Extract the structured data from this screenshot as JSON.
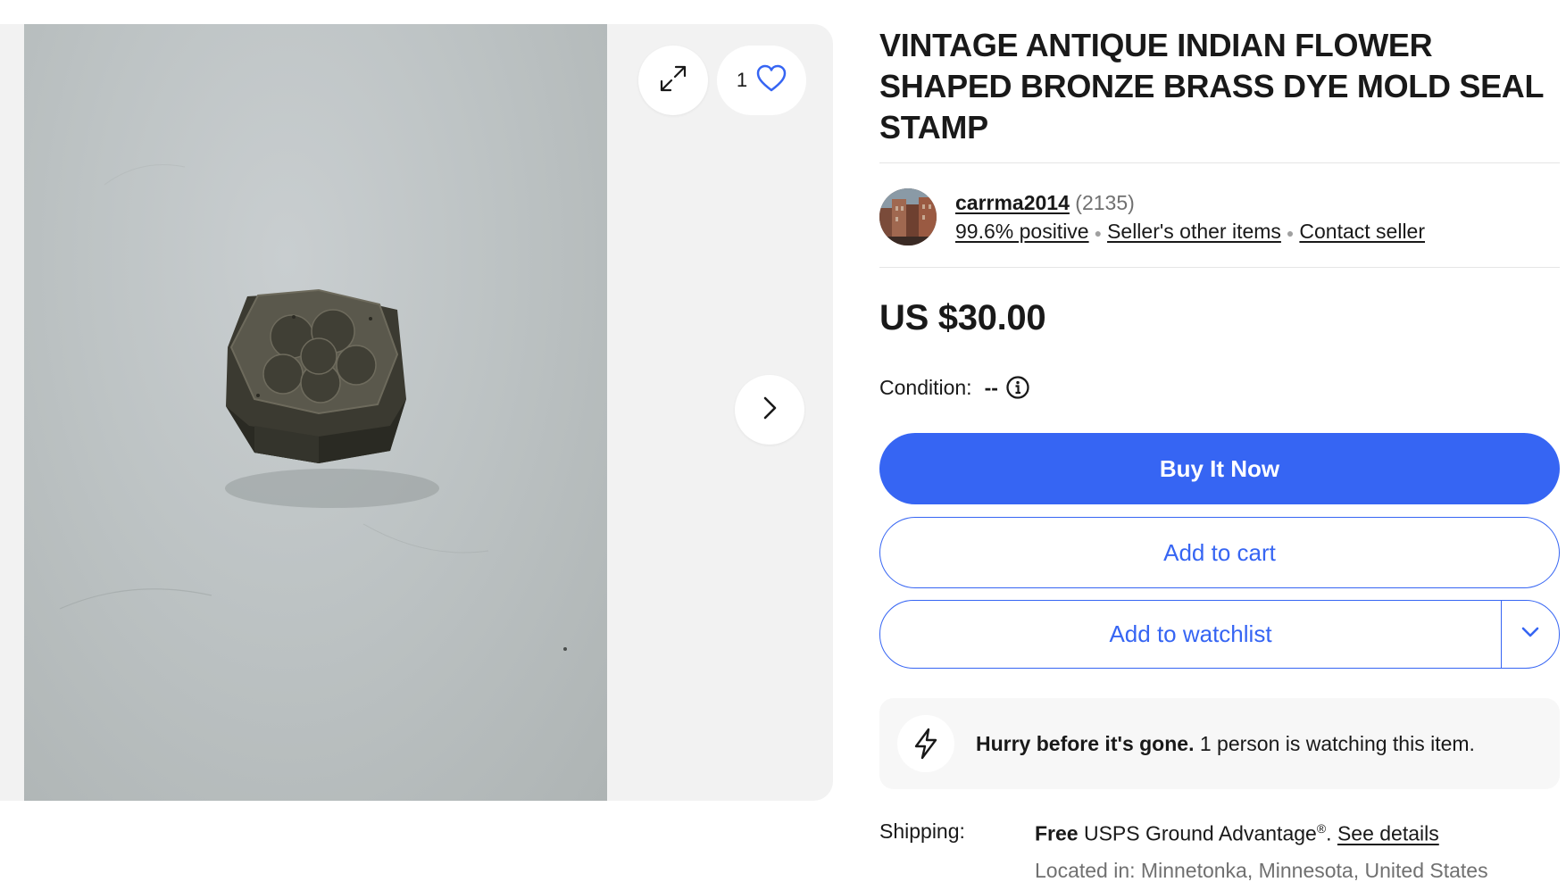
{
  "gallery": {
    "like_count": "1",
    "colors": {
      "background": "#f2f2f2"
    }
  },
  "listing": {
    "title": "VINTAGE ANTIQUE INDIAN FLOWER SHAPED BRONZE BRASS DYE MOLD SEAL STAMP",
    "price": "US $30.00"
  },
  "seller": {
    "name": "carrma2014",
    "feedback_count": "(2135)",
    "positive": "99.6% positive",
    "other_items": "Seller's other items",
    "contact": "Contact seller"
  },
  "condition": {
    "label": "Condition:",
    "value": "--"
  },
  "actions": {
    "buy_now": "Buy It Now",
    "add_to_cart": "Add to cart",
    "add_to_watchlist": "Add to watchlist"
  },
  "urgency": {
    "bold": "Hurry before it's gone.",
    "text": " 1 person is watching this item."
  },
  "shipping": {
    "label": "Shipping:",
    "free": "Free",
    "service": " USPS Ground Advantage",
    "registered": "®",
    "period": ". ",
    "see_details": "See details",
    "located": "Located in: Minnetonka, Minnesota, United States"
  },
  "theme": {
    "accent": "#3665f3",
    "text": "#191919",
    "muted": "#707070"
  },
  "icons": [
    "expand-icon",
    "heart-icon",
    "chevron-right-icon",
    "info-icon",
    "chevron-down-icon",
    "lightning-bolt-icon"
  ]
}
